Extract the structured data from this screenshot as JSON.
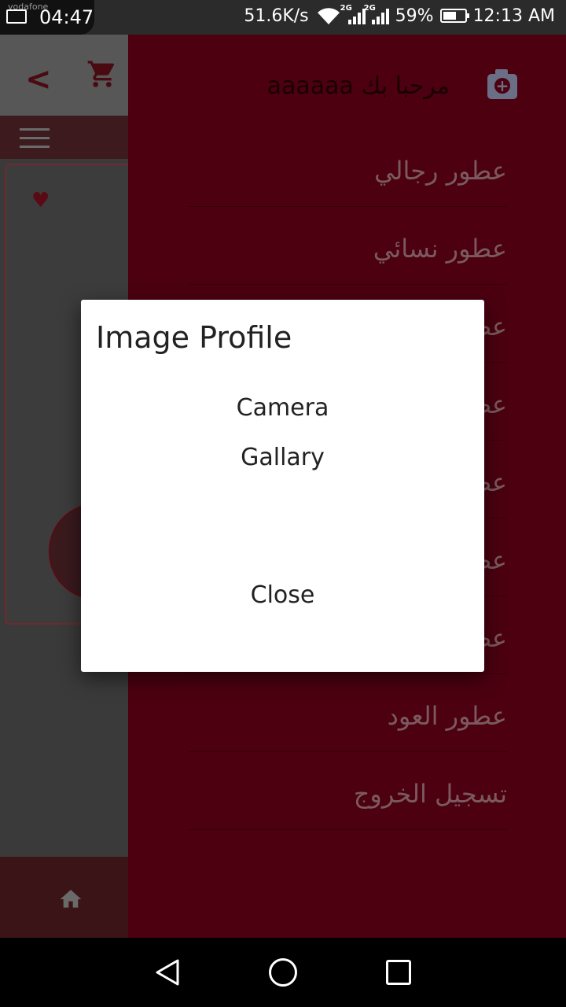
{
  "status_bar": {
    "carrier": "vodafone",
    "time_left": "04:47",
    "net_speed": "51.6K/s",
    "signal_labels": [
      "2G",
      "2G"
    ],
    "battery": "59%",
    "clock": "12:13 AM"
  },
  "drawer": {
    "welcome": "مرحبا بك  aaaaaa",
    "items": [
      {
        "label": "عطور رجالي"
      },
      {
        "label": "عطور نسائي"
      },
      {
        "label": "عط"
      },
      {
        "label": "عط"
      },
      {
        "label": "عط"
      },
      {
        "label": "عط"
      },
      {
        "label": "عط"
      },
      {
        "label": "عطور العود"
      },
      {
        "label": "تسجيل الخروج"
      }
    ]
  },
  "dialog": {
    "title": "Image Profile",
    "options": [
      "Camera",
      "Gallary"
    ],
    "close_label": "Close"
  },
  "colors": {
    "drawer_bg": "#4c0010",
    "accent": "#5a0a14"
  }
}
